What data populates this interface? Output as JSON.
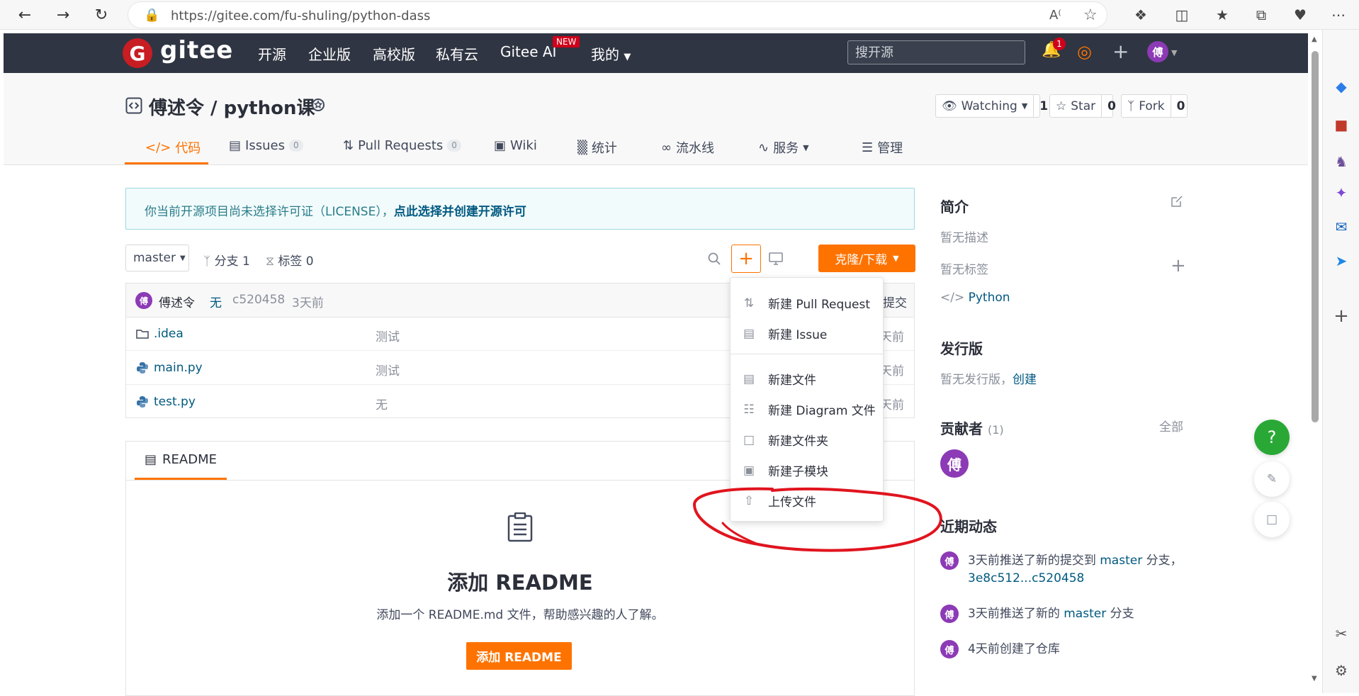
{
  "browser": {
    "url": "https://gitee.com/fu-shuling/python-dass"
  },
  "header": {
    "logo_letter": "G",
    "logo_text": "gitee",
    "nav": [
      "开源",
      "企业版",
      "高校版",
      "私有云",
      "Gitee AI",
      "我的"
    ],
    "new_badge": "NEW",
    "search_placeholder": "搜开源",
    "notification_count": "1",
    "avatar_letter": "傅"
  },
  "repo": {
    "title": "傅述令 / python课",
    "watching": {
      "label": "Watching",
      "count": "1"
    },
    "star": {
      "label": "Star",
      "count": "0"
    },
    "fork": {
      "label": "Fork",
      "count": "0"
    },
    "tabs": [
      {
        "label": "代码"
      },
      {
        "label": "Issues",
        "badge": "0"
      },
      {
        "label": "Pull Requests",
        "badge": "0"
      },
      {
        "label": "Wiki"
      },
      {
        "label": "统计"
      },
      {
        "label": "流水线"
      },
      {
        "label": "服务"
      },
      {
        "label": "管理"
      }
    ]
  },
  "license": {
    "text": "你当前开源项目尚未选择许可证（LICENSE），",
    "link": "点此选择并创建开源许可"
  },
  "branch": {
    "name": "master",
    "branches": "分支 1",
    "tags": "标签 0",
    "clone_label": "克隆/下载"
  },
  "commit": {
    "author": "傅述令",
    "message": "无",
    "hash": "c520458",
    "time": "3天前",
    "tail": "提交",
    "avatar_letter": "傅"
  },
  "files": [
    {
      "name": ".idea",
      "message": "测试",
      "time": "天前",
      "kind": "folder"
    },
    {
      "name": "main.py",
      "message": "测试",
      "time": "天前",
      "kind": "python"
    },
    {
      "name": "test.py",
      "message": "无",
      "time": "天前",
      "kind": "python"
    }
  ],
  "readme": {
    "tab_label": "README",
    "title": "添加 README",
    "description": "添加一个 README.md 文件，帮助感兴趣的人了解。",
    "button": "添加 README"
  },
  "dropdown": {
    "items": [
      {
        "label": "新建 Pull Request"
      },
      {
        "label": "新建 Issue"
      },
      {
        "label": "新建文件"
      },
      {
        "label": "新建 Diagram 文件"
      },
      {
        "label": "新建文件夹"
      },
      {
        "label": "新建子模块"
      },
      {
        "label": "上传文件"
      }
    ]
  },
  "sidebar": {
    "intro_title": "简介",
    "no_desc": "暂无描述",
    "no_tags": "暂无标签",
    "language": "Python",
    "release_title": "发行版",
    "no_release": "暂无发行版，",
    "create_link": "创建",
    "contributors_title": "贡献者",
    "contributors_count": "(1)",
    "all_link": "全部",
    "contributor_letter": "傅",
    "activity_title": "近期动态",
    "activities": [
      {
        "prefix": "3天前推送了新的提交到 ",
        "branch": "master",
        "suffix": " 分支，",
        "extra": "3e8c512...c520458"
      },
      {
        "prefix": "3天前推送了新的 ",
        "branch": "master",
        "suffix": " 分支",
        "extra": ""
      },
      {
        "prefix": "4天前创建了仓库",
        "branch": "",
        "suffix": "",
        "extra": ""
      }
    ]
  },
  "fab": {
    "help": "?"
  },
  "colors": {
    "accent": "#fe7300",
    "header_bg": "#2f3542",
    "link": "#005980",
    "annotation": "#e0141e"
  }
}
